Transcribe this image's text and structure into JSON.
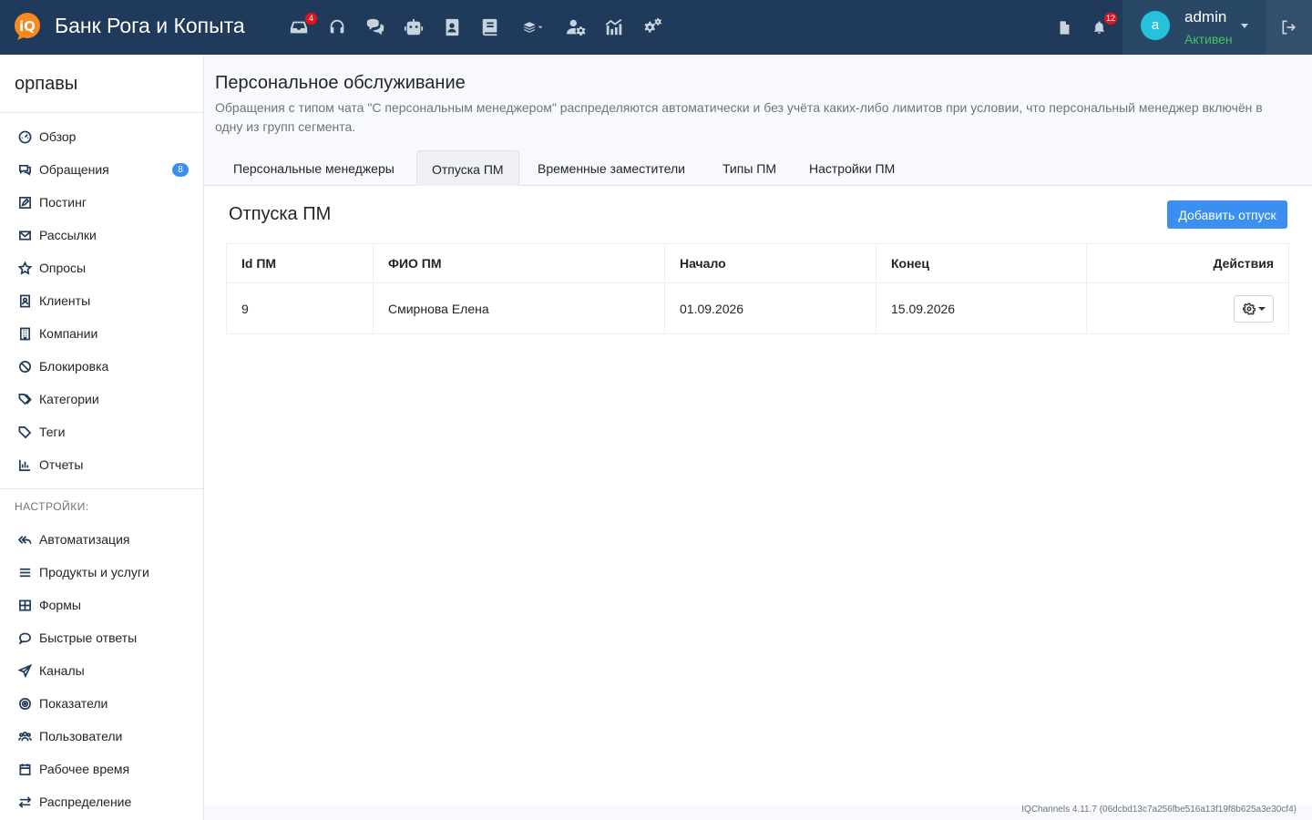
{
  "header": {
    "brand": "Банк Рога и Копыта",
    "nav_badges": {
      "inbox": "4",
      "notifications": "12"
    },
    "user": {
      "avatar_letter": "a",
      "name": "admin",
      "status": "Активен"
    },
    "colors": {
      "topbar": "#1f3a5a",
      "accent": "#3a8ff0",
      "badge": "#e8121d",
      "status": "#3cc45f"
    }
  },
  "sidebar": {
    "org_name": "орпавы",
    "items": [
      {
        "label": "Обзор",
        "icon": "dashboard-icon"
      },
      {
        "label": "Обращения",
        "icon": "chat-icon",
        "badge": "8"
      },
      {
        "label": "Постинг",
        "icon": "edit-icon"
      },
      {
        "label": "Рассылки",
        "icon": "mail-icon"
      },
      {
        "label": "Опросы",
        "icon": "star-icon"
      },
      {
        "label": "Клиенты",
        "icon": "contact-icon"
      },
      {
        "label": "Компании",
        "icon": "building-icon"
      },
      {
        "label": "Блокировка",
        "icon": "block-icon"
      },
      {
        "label": "Категории",
        "icon": "tag-icon"
      },
      {
        "label": "Теги",
        "icon": "tag-icon"
      },
      {
        "label": "Отчеты",
        "icon": "chart-icon"
      }
    ],
    "settings_title": "НАСТРОЙКИ:",
    "settings_items": [
      {
        "label": "Автоматизация",
        "icon": "reply-all-icon"
      },
      {
        "label": "Продукты и услуги",
        "icon": "list-icon"
      },
      {
        "label": "Формы",
        "icon": "grid-icon"
      },
      {
        "label": "Быстрые ответы",
        "icon": "comment-icon"
      },
      {
        "label": "Каналы",
        "icon": "send-icon"
      },
      {
        "label": "Показатели",
        "icon": "target-icon"
      },
      {
        "label": "Пользователи",
        "icon": "users-icon"
      },
      {
        "label": "Рабочее время",
        "icon": "calendar-icon"
      },
      {
        "label": "Распределение",
        "icon": "swap-icon"
      }
    ]
  },
  "main": {
    "title": "Персональное обслуживание",
    "description": "Обращения с типом чата \"С персональным менеджером\" распределяются автоматически и без учёта каких-либо лимитов при условии, что персональный менеджер включён в одну из групп сегмента.",
    "tabs": [
      {
        "label": "Персональные менеджеры"
      },
      {
        "label": "Отпуска ПМ",
        "active": true
      },
      {
        "label": "Временные заместители"
      },
      {
        "label": "Типы ПМ"
      },
      {
        "label": "Настройки ПМ"
      }
    ],
    "section_title": "Отпуска ПМ",
    "add_button": "Добавить отпуск",
    "table": {
      "headers": [
        "Id ПМ",
        "ФИО ПМ",
        "Начало",
        "Конец",
        "Действия"
      ],
      "rows": [
        {
          "id": "9",
          "name": "Смирнова Елена",
          "start": "01.09.2026",
          "end": "15.09.2026"
        }
      ]
    }
  },
  "footer": {
    "version": "IQChannels 4.11.7 (06dcbd13c7a256fbe516a13f19f8b625a3e30cf4)"
  }
}
